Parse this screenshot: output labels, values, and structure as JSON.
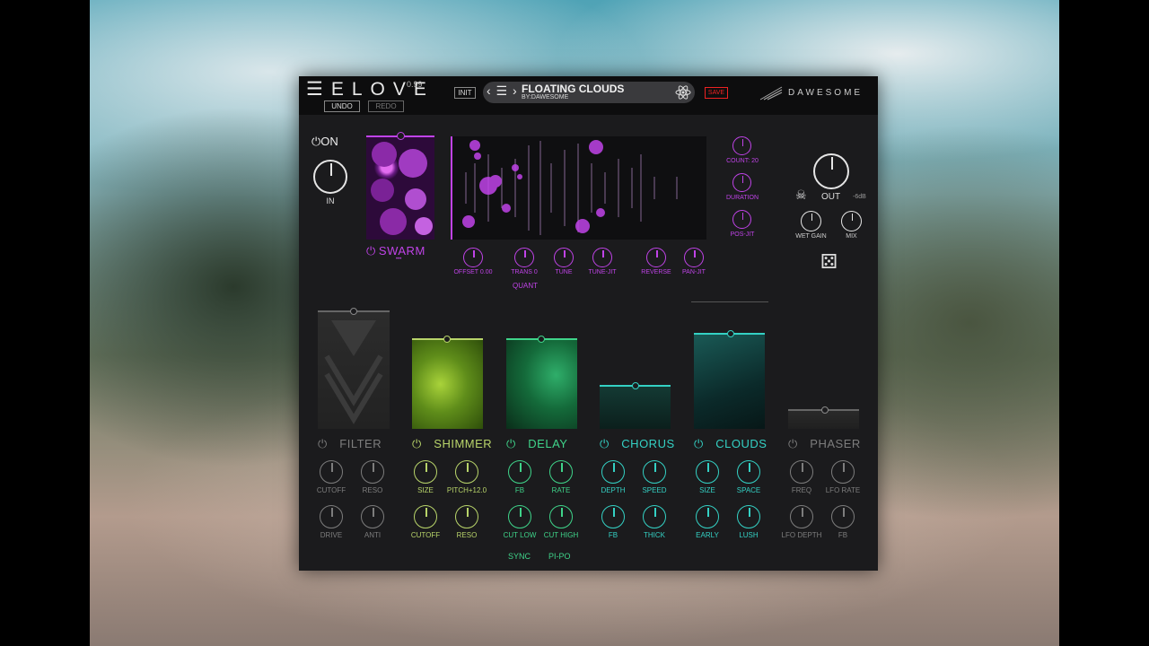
{
  "header": {
    "logo": "ELOVE",
    "version": "0.99",
    "undo": "UNDO",
    "redo": "REDO",
    "init": "INIT",
    "save": "SAVE",
    "brand": "DAWESOME"
  },
  "preset": {
    "name": "FLOATING CLOUDS",
    "by": "BY:DAWESOME",
    "nav": "‹ ☰ ›"
  },
  "main": {
    "on_label": "ON",
    "in_label": "IN",
    "out_label": "OUT",
    "out_db": "-6dB",
    "wet_gain": "WET GAIN",
    "mix": "MIX"
  },
  "swarm": {
    "name": "SWARM",
    "dots": "•••",
    "side_knobs": [
      "COUNT: 20",
      "DURATION",
      "POS-JIT"
    ],
    "bottom_knobs": [
      "OFFSET 0.00",
      "TRANS 0",
      "TUNE",
      "TUNE-JIT",
      "REVERSE",
      "PAN-JIT"
    ],
    "quant": "QUANT"
  },
  "fx": [
    {
      "name": "FILTER",
      "knobs": [
        "CUTOFF",
        "RESO",
        "DRIVE",
        "ANTI"
      ],
      "color": "#7d7d7d"
    },
    {
      "name": "SHIMMER",
      "knobs": [
        "SIZE",
        "PITCH+12.0",
        "CUTOFF",
        "RESO"
      ],
      "color": "#b8d46a"
    },
    {
      "name": "DELAY",
      "knobs": [
        "FB",
        "RATE",
        "CUT LOW",
        "CUT HIGH"
      ],
      "color": "#3fd48a",
      "extras": [
        "SYNC",
        "PI-PO"
      ]
    },
    {
      "name": "CHORUS",
      "knobs": [
        "DEPTH",
        "SPEED",
        "FB",
        "THICK"
      ],
      "color": "#34d1c4"
    },
    {
      "name": "CLOUDS",
      "knobs": [
        "SIZE",
        "SPACE",
        "EARLY",
        "LUSH"
      ],
      "color": "#34d1c4"
    },
    {
      "name": "PHASER",
      "knobs": [
        "FREQ",
        "LFO RATE",
        "LFO DEPTH",
        "FB"
      ],
      "color": "#7d7d7d"
    }
  ],
  "colors": {
    "accent_purple": "#c043e8",
    "shimmer": "#b8d46a",
    "delay": "#3fd48a",
    "teal": "#34d1c4",
    "save_red": "#e22222"
  }
}
